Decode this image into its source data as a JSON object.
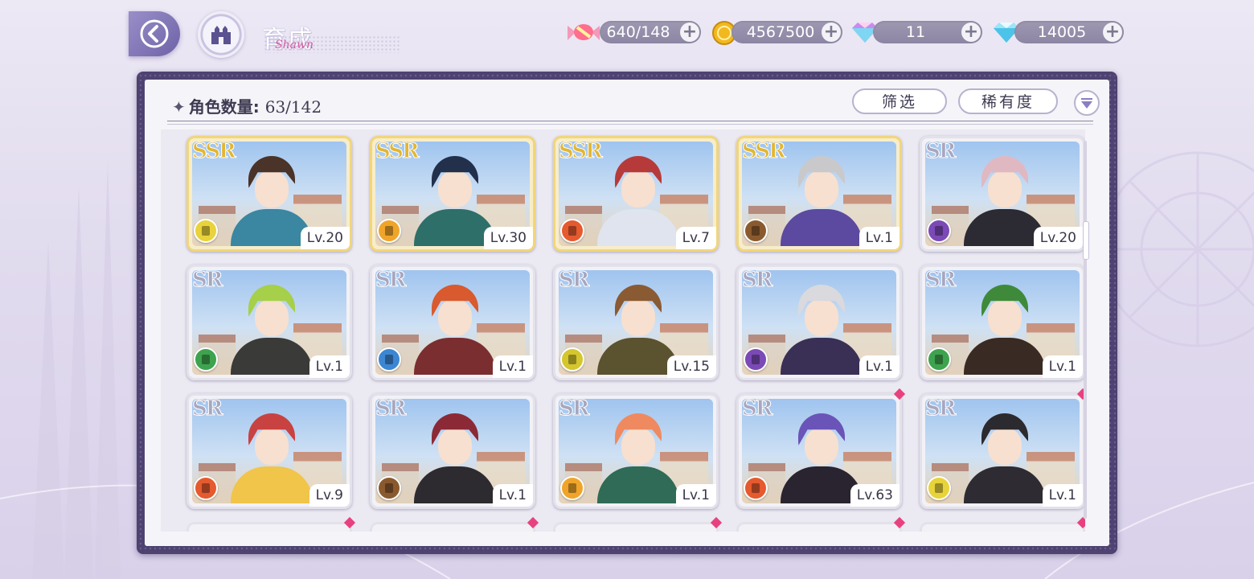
{
  "header": {
    "title": "育成",
    "signature": "Shawn"
  },
  "currencies": [
    {
      "name": "candy",
      "icon": "candy-icon",
      "value": "640/148"
    },
    {
      "name": "gold",
      "icon": "gold-coin-icon",
      "value": "4567500"
    },
    {
      "name": "rainbow-gem",
      "icon": "rainbow-diamond-icon",
      "value": "11"
    },
    {
      "name": "diamond",
      "icon": "blue-diamond-icon",
      "value": "14005"
    }
  ],
  "panel": {
    "count_label": "角色数量:",
    "count_value": "63/142",
    "filter_label": "筛选",
    "sort_label": "稀有度"
  },
  "colors": {
    "accent": "#6e62a8",
    "frame": "#4d4270",
    "ssr_border": "#f1d67a",
    "new_badge": "#e8417f"
  },
  "characters": [
    {
      "rarity": "SSR",
      "level": "Lv.20",
      "role_color": "#e8d33a",
      "hair": "#4a3328",
      "body": "#3b86a0",
      "new": false
    },
    {
      "rarity": "SSR",
      "level": "Lv.30",
      "role_color": "#f0a52a",
      "hair": "#23304c",
      "body": "#2f6f6a",
      "new": false
    },
    {
      "rarity": "SSR",
      "level": "Lv.7",
      "role_color": "#e55a2e",
      "hair": "#b73a3a",
      "body": "#dfe4ef",
      "new": false
    },
    {
      "rarity": "SSR",
      "level": "Lv.1",
      "role_color": "#8a5a2e",
      "hair": "#c9c9cc",
      "body": "#5b4aa0",
      "new": false
    },
    {
      "rarity": "SR",
      "level": "Lv.20",
      "role_color": "#7b4ab6",
      "hair": "#e0b8c2",
      "body": "#2c2a33",
      "new": false
    },
    {
      "rarity": "SR",
      "level": "Lv.1",
      "role_color": "#3ea34e",
      "hair": "#a6cf4a",
      "body": "#3a3a38",
      "new": false
    },
    {
      "rarity": "SR",
      "level": "Lv.1",
      "role_color": "#3d86d3",
      "hair": "#d85a2e",
      "body": "#7a2e30",
      "new": false
    },
    {
      "rarity": "SR",
      "level": "Lv.15",
      "role_color": "#d5c62e",
      "hair": "#8a5a32",
      "body": "#5b5230",
      "new": false
    },
    {
      "rarity": "SR",
      "level": "Lv.1",
      "role_color": "#7b4ab6",
      "hair": "#d9d9de",
      "body": "#3a2f55",
      "new": false
    },
    {
      "rarity": "SR",
      "level": "Lv.1",
      "role_color": "#3ea34e",
      "hair": "#3e8a3a",
      "body": "#3a2a24",
      "new": false
    },
    {
      "rarity": "SR",
      "level": "Lv.9",
      "role_color": "#e55a2e",
      "hair": "#c94242",
      "body": "#f1c44a",
      "new": false
    },
    {
      "rarity": "SR",
      "level": "Lv.1",
      "role_color": "#8a5a2e",
      "hair": "#8b2a36",
      "body": "#2d2b30",
      "new": false
    },
    {
      "rarity": "SR",
      "level": "Lv.1",
      "role_color": "#f0a52a",
      "hair": "#ef8a60",
      "body": "#2f6b56",
      "new": false
    },
    {
      "rarity": "SR",
      "level": "Lv.63",
      "role_color": "#e55a2e",
      "hair": "#6a54b8",
      "body": "#2a2430",
      "new": true
    },
    {
      "rarity": "SR",
      "level": "Lv.1",
      "role_color": "#e8d33a",
      "hair": "#2b2a2e",
      "body": "#2e2c32",
      "new": true
    }
  ],
  "partial_row_new": [
    true,
    true,
    true,
    true,
    true
  ]
}
